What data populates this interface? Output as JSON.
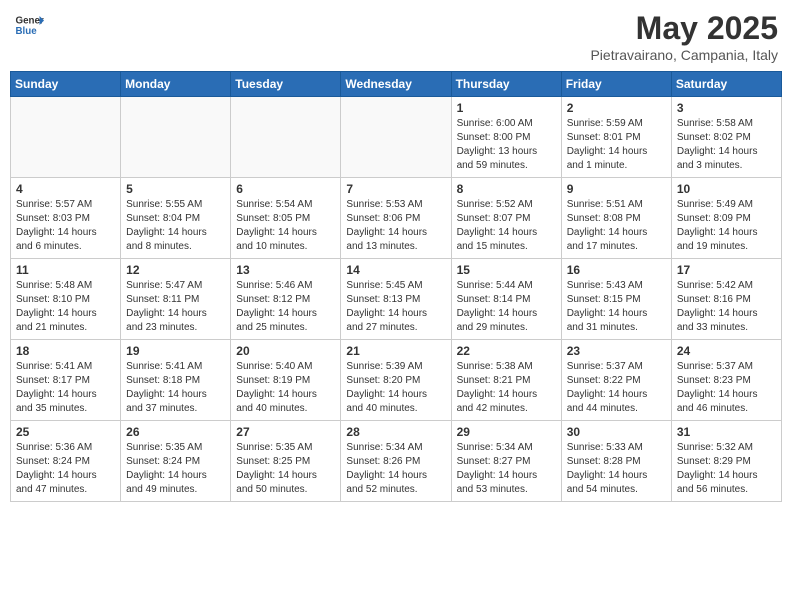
{
  "header": {
    "logo_general": "General",
    "logo_blue": "Blue",
    "month": "May 2025",
    "location": "Pietravairano, Campania, Italy"
  },
  "weekdays": [
    "Sunday",
    "Monday",
    "Tuesday",
    "Wednesday",
    "Thursday",
    "Friday",
    "Saturday"
  ],
  "weeks": [
    [
      {
        "day": "",
        "info": ""
      },
      {
        "day": "",
        "info": ""
      },
      {
        "day": "",
        "info": ""
      },
      {
        "day": "",
        "info": ""
      },
      {
        "day": "1",
        "info": "Sunrise: 6:00 AM\nSunset: 8:00 PM\nDaylight: 13 hours\nand 59 minutes."
      },
      {
        "day": "2",
        "info": "Sunrise: 5:59 AM\nSunset: 8:01 PM\nDaylight: 14 hours\nand 1 minute."
      },
      {
        "day": "3",
        "info": "Sunrise: 5:58 AM\nSunset: 8:02 PM\nDaylight: 14 hours\nand 3 minutes."
      }
    ],
    [
      {
        "day": "4",
        "info": "Sunrise: 5:57 AM\nSunset: 8:03 PM\nDaylight: 14 hours\nand 6 minutes."
      },
      {
        "day": "5",
        "info": "Sunrise: 5:55 AM\nSunset: 8:04 PM\nDaylight: 14 hours\nand 8 minutes."
      },
      {
        "day": "6",
        "info": "Sunrise: 5:54 AM\nSunset: 8:05 PM\nDaylight: 14 hours\nand 10 minutes."
      },
      {
        "day": "7",
        "info": "Sunrise: 5:53 AM\nSunset: 8:06 PM\nDaylight: 14 hours\nand 13 minutes."
      },
      {
        "day": "8",
        "info": "Sunrise: 5:52 AM\nSunset: 8:07 PM\nDaylight: 14 hours\nand 15 minutes."
      },
      {
        "day": "9",
        "info": "Sunrise: 5:51 AM\nSunset: 8:08 PM\nDaylight: 14 hours\nand 17 minutes."
      },
      {
        "day": "10",
        "info": "Sunrise: 5:49 AM\nSunset: 8:09 PM\nDaylight: 14 hours\nand 19 minutes."
      }
    ],
    [
      {
        "day": "11",
        "info": "Sunrise: 5:48 AM\nSunset: 8:10 PM\nDaylight: 14 hours\nand 21 minutes."
      },
      {
        "day": "12",
        "info": "Sunrise: 5:47 AM\nSunset: 8:11 PM\nDaylight: 14 hours\nand 23 minutes."
      },
      {
        "day": "13",
        "info": "Sunrise: 5:46 AM\nSunset: 8:12 PM\nDaylight: 14 hours\nand 25 minutes."
      },
      {
        "day": "14",
        "info": "Sunrise: 5:45 AM\nSunset: 8:13 PM\nDaylight: 14 hours\nand 27 minutes."
      },
      {
        "day": "15",
        "info": "Sunrise: 5:44 AM\nSunset: 8:14 PM\nDaylight: 14 hours\nand 29 minutes."
      },
      {
        "day": "16",
        "info": "Sunrise: 5:43 AM\nSunset: 8:15 PM\nDaylight: 14 hours\nand 31 minutes."
      },
      {
        "day": "17",
        "info": "Sunrise: 5:42 AM\nSunset: 8:16 PM\nDaylight: 14 hours\nand 33 minutes."
      }
    ],
    [
      {
        "day": "18",
        "info": "Sunrise: 5:41 AM\nSunset: 8:17 PM\nDaylight: 14 hours\nand 35 minutes."
      },
      {
        "day": "19",
        "info": "Sunrise: 5:41 AM\nSunset: 8:18 PM\nDaylight: 14 hours\nand 37 minutes."
      },
      {
        "day": "20",
        "info": "Sunrise: 5:40 AM\nSunset: 8:19 PM\nDaylight: 14 hours\nand 40 minutes."
      },
      {
        "day": "21",
        "info": "Sunrise: 5:39 AM\nSunset: 8:20 PM\nDaylight: 14 hours\nand 40 minutes."
      },
      {
        "day": "22",
        "info": "Sunrise: 5:38 AM\nSunset: 8:21 PM\nDaylight: 14 hours\nand 42 minutes."
      },
      {
        "day": "23",
        "info": "Sunrise: 5:37 AM\nSunset: 8:22 PM\nDaylight: 14 hours\nand 44 minutes."
      },
      {
        "day": "24",
        "info": "Sunrise: 5:37 AM\nSunset: 8:23 PM\nDaylight: 14 hours\nand 46 minutes."
      }
    ],
    [
      {
        "day": "25",
        "info": "Sunrise: 5:36 AM\nSunset: 8:24 PM\nDaylight: 14 hours\nand 47 minutes."
      },
      {
        "day": "26",
        "info": "Sunrise: 5:35 AM\nSunset: 8:24 PM\nDaylight: 14 hours\nand 49 minutes."
      },
      {
        "day": "27",
        "info": "Sunrise: 5:35 AM\nSunset: 8:25 PM\nDaylight: 14 hours\nand 50 minutes."
      },
      {
        "day": "28",
        "info": "Sunrise: 5:34 AM\nSunset: 8:26 PM\nDaylight: 14 hours\nand 52 minutes."
      },
      {
        "day": "29",
        "info": "Sunrise: 5:34 AM\nSunset: 8:27 PM\nDaylight: 14 hours\nand 53 minutes."
      },
      {
        "day": "30",
        "info": "Sunrise: 5:33 AM\nSunset: 8:28 PM\nDaylight: 14 hours\nand 54 minutes."
      },
      {
        "day": "31",
        "info": "Sunrise: 5:32 AM\nSunset: 8:29 PM\nDaylight: 14 hours\nand 56 minutes."
      }
    ]
  ]
}
